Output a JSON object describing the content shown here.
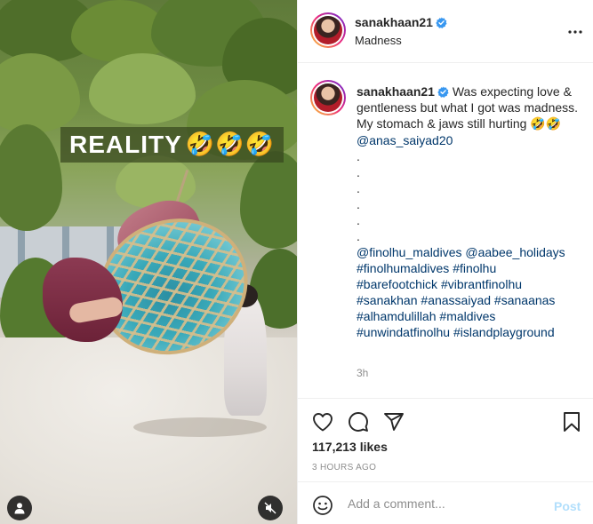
{
  "media": {
    "overlay_text": "REALITY",
    "overlay_emojis": "🤣🤣🤣",
    "tag_icon": "person-icon",
    "mute_icon": "speaker-muted-icon"
  },
  "header": {
    "username": "sanakhaan21",
    "verified_icon": "verified-badge-icon",
    "location": "Madness",
    "more_icon": "more-horizontal-icon"
  },
  "caption": {
    "username": "sanakhaan21",
    "text_1": "Was expecting love & gentleness but what I got was madness.",
    "text_2": "My stomach & jaws still hurting",
    "text_2_emoji": "🤣🤣",
    "mention": "@anas_saiyad20",
    "dots": [
      ".",
      ".",
      ".",
      ".",
      ".",
      "."
    ],
    "hashtag_lines": [
      [
        "@finolhu_maldives",
        "@aabee_holidays"
      ],
      [
        "#finolhumaldives",
        "#finolhu"
      ],
      [
        "#barefootchick",
        "#vibrantfinolhu"
      ],
      [
        "#sanakhan",
        "#anassaiyad",
        "#sanaanas"
      ],
      [
        "#alhamdulillah",
        "#maldives"
      ],
      [
        "#unwindatfinolhu",
        "#islandplayground"
      ]
    ],
    "time": "3h"
  },
  "actions": {
    "like_icon": "heart-icon",
    "comment_icon": "comment-icon",
    "share_icon": "paper-plane-icon",
    "save_icon": "bookmark-icon",
    "likes": "117,213 likes",
    "posted_ago": "3 HOURS AGO"
  },
  "comment": {
    "emoji_icon": "smiley-icon",
    "placeholder": "Add a comment...",
    "post_label": "Post"
  },
  "colors": {
    "link": "#00376b",
    "verified": "#3897f0",
    "post_disabled": "#b2dffc",
    "muted_text": "#8e8e8e"
  }
}
